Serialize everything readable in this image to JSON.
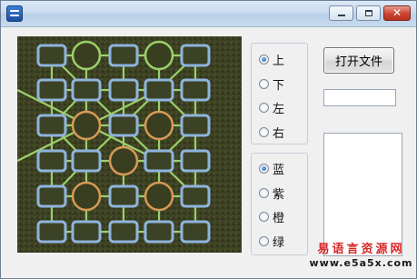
{
  "window": {
    "title": ""
  },
  "radio_group_direction": {
    "options": [
      {
        "label": "上",
        "checked": true
      },
      {
        "label": "下",
        "checked": false
      },
      {
        "label": "左",
        "checked": false
      },
      {
        "label": "右",
        "checked": false
      }
    ]
  },
  "radio_group_color": {
    "options": [
      {
        "label": "蓝",
        "checked": true
      },
      {
        "label": "紫",
        "checked": false
      },
      {
        "label": "橙",
        "checked": false
      },
      {
        "label": "绿",
        "checked": false
      }
    ]
  },
  "open_file_button": {
    "label": "打开文件"
  },
  "text_input": {
    "value": ""
  },
  "watermark": {
    "cn": "易语言资源网",
    "url": "www.e5a5x.com"
  },
  "board": {
    "theme_color": "blue",
    "direction": "up"
  }
}
